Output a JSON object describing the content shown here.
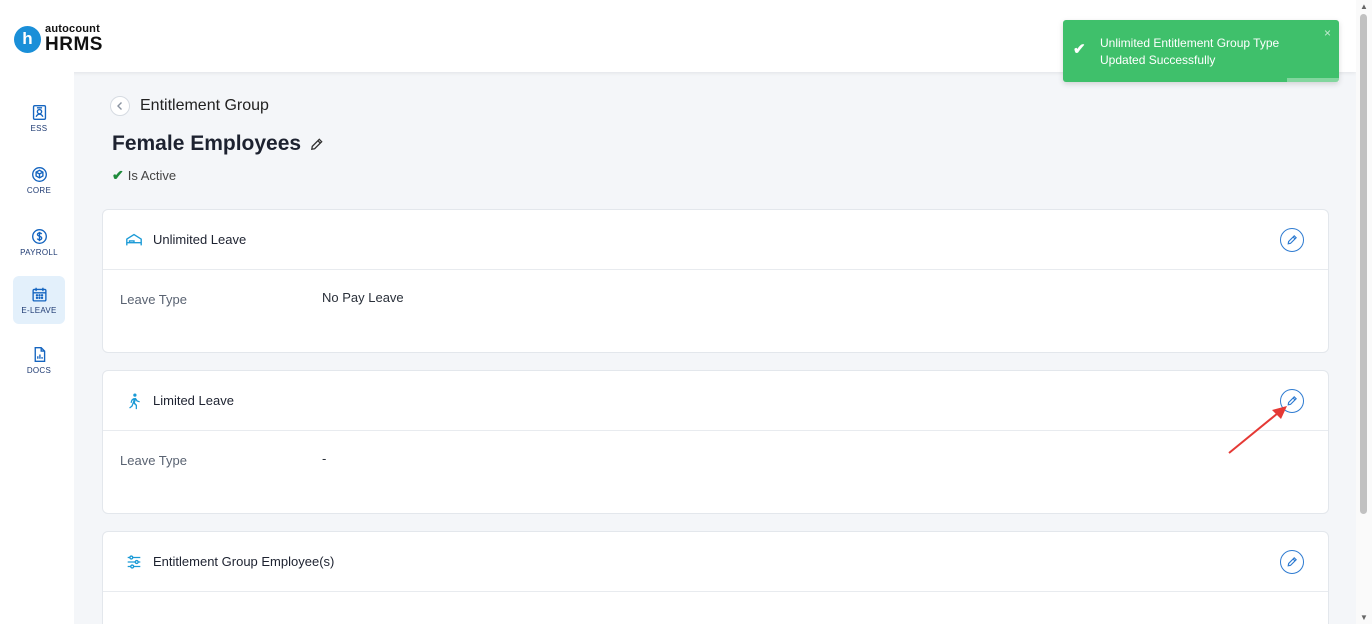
{
  "app": {
    "logo_top": "autocount",
    "logo_bottom": "HRMS",
    "logo_letter": "h"
  },
  "sidebar": {
    "items": [
      {
        "label": "ESS",
        "icon": "ess-icon"
      },
      {
        "label": "CORE",
        "icon": "cube-icon"
      },
      {
        "label": "PAYROLL",
        "icon": "dollar-icon"
      },
      {
        "label": "E-LEAVE",
        "icon": "calendar-icon",
        "active": true
      },
      {
        "label": "DOCS",
        "icon": "document-icon"
      }
    ]
  },
  "breadcrumb": {
    "back_label": "Entitlement Group"
  },
  "page": {
    "title": "Female Employees",
    "status": "Is Active"
  },
  "cards": [
    {
      "title": "Unlimited Leave",
      "icon": "bed-icon",
      "field_label": "Leave Type",
      "field_value": "No Pay Leave"
    },
    {
      "title": "Limited Leave",
      "icon": "walking-icon",
      "field_label": "Leave Type",
      "field_value": "-"
    },
    {
      "title": "Entitlement Group Employee(s)",
      "icon": "sliders-icon"
    }
  ],
  "toast": {
    "message": "Unlimited Entitlement Group Type Updated Successfully",
    "close": "×",
    "type": "success",
    "color": "#3fc06b"
  },
  "colors": {
    "accent": "#1a8fd8",
    "edit_border": "#2e7bd1",
    "success": "#3fc06b",
    "annotation_arrow": "#e53935"
  }
}
